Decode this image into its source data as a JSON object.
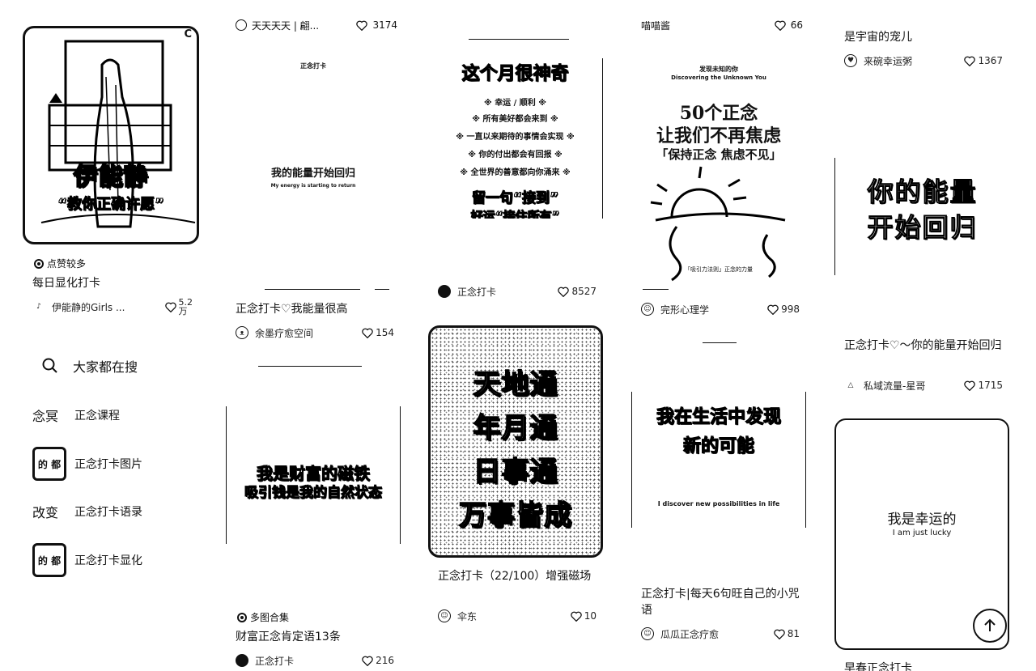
{
  "col1": {
    "card1": {
      "cover_line1": "伊能静",
      "cover_line2": "“教你正确许愿”",
      "cover_corner": "C",
      "tag": "点赞较多",
      "title": "每日显化打卡",
      "author": "伊能静的Girls ...",
      "likes_top": "5.2",
      "likes_bottom": "万"
    },
    "search": {
      "icon": "search-icon",
      "heading": "大家都在搜",
      "items": [
        {
          "label": "正念课程",
          "thumb": "念冥"
        },
        {
          "label": "正念打卡图片",
          "thumb": "的 都"
        },
        {
          "label": "正念打卡语录",
          "thumb": "改变"
        },
        {
          "label": "正念打卡显化",
          "thumb": "的 都"
        }
      ]
    }
  },
  "col2": {
    "cut": {
      "author": "天天天天 | 翩...",
      "likes": "3174"
    },
    "card1": {
      "cover_small": "正念打卡",
      "cover_main": "我的能量开始回归",
      "cover_en": "My energy is starting to return",
      "title": "正念打卡♡我能量很高",
      "author": "余墨疗愈空间",
      "likes": "154"
    },
    "card2": {
      "cover_line1": "我是财富的磁铁",
      "cover_line2": "吸引钱是我的自然状态",
      "tag": "多图合集",
      "title": "财富正念肯定语13条",
      "author": "正念打卡",
      "likes": "216"
    }
  },
  "col3": {
    "card1": {
      "cover_title": "这个月很神奇",
      "cover_lines": [
        "※ 幸运 / 顺利 ※",
        "※ 所有美好都会来到 ※",
        "※ 一直以来期待的事情会实现 ※",
        "※ 你的付出都会有回报 ※",
        "※ 全世界的善意都向你涌来 ※"
      ],
      "cover_bottom1": "留一句“接到”",
      "cover_bottom2": "好运“接住所有”",
      "author": "正念打卡",
      "likes": "8527"
    },
    "card2": {
      "cover_lines": [
        "天地通",
        "年月通",
        "日事通",
        "万事皆成"
      ],
      "title": "正念打卡（22/100）增强磁场",
      "author": "伞东",
      "likes": "10"
    }
  },
  "col4": {
    "cut": {
      "author": "喵喵酱",
      "likes": "66"
    },
    "card1": {
      "cover_small1": "发现未知的你",
      "cover_small2": "Discovering the Unknown You",
      "cover_line1": "50个正念",
      "cover_line2": "让我们不再焦虑",
      "cover_line3": "「保持正念 焦虑不见」",
      "cover_foot": "「吸引力法则」正念的力量",
      "author": "完形心理学",
      "likes": "998"
    },
    "card2": {
      "cover_line1": "我在生活中发现",
      "cover_line2": "新的可能",
      "cover_en": "I discover new possibilities in life",
      "title": "正念打卡|每天6句旺自己的小咒语",
      "author": "瓜瓜正念疗愈",
      "likes": "81"
    }
  },
  "col5": {
    "card0": {
      "title_tail": "是宇宙的宠儿",
      "author": "来碗幸运粥",
      "likes": "1367"
    },
    "card1": {
      "cover_line1": "你的能量",
      "cover_line2": "开始回归",
      "title": "正念打卡♡～你的能量开始回归",
      "author": "私域流量-星哥",
      "likes": "1715"
    },
    "card2": {
      "cover_line1": "我是幸运的",
      "cover_en": "I am just lucky",
      "title_cut": "早春正念打卡"
    },
    "scroll_top_icon": "arrow-up-icon"
  }
}
